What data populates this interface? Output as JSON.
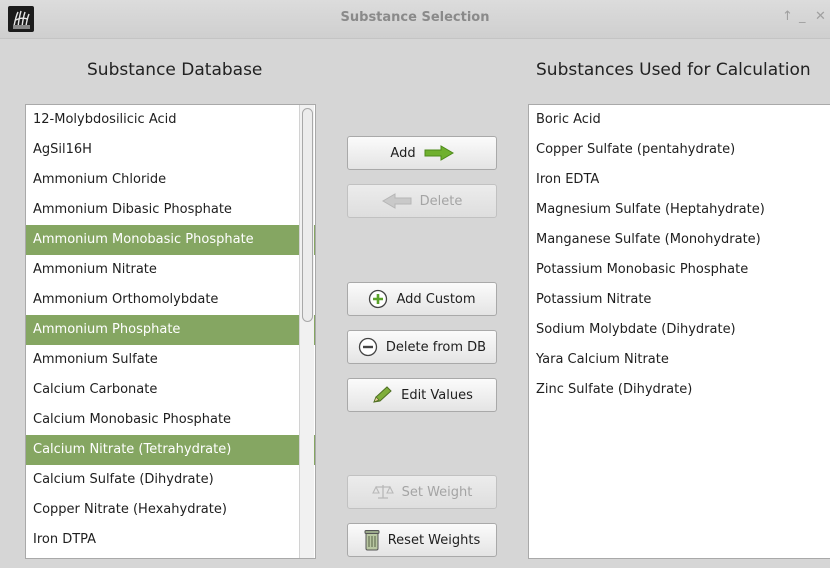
{
  "window": {
    "title": "Substance Selection",
    "controls": [
      "↑",
      "_",
      "✕"
    ]
  },
  "database": {
    "heading": "Substance Database",
    "items": [
      "12-Molybdosilicic Acid",
      "AgSil16H",
      "Ammonium Chloride",
      "Ammonium Dibasic Phosphate",
      "Ammonium Monobasic Phosphate",
      "Ammonium Nitrate",
      "Ammonium Orthomolybdate",
      "Ammonium Phosphate",
      "Ammonium Sulfate",
      "Calcium Carbonate",
      "Calcium Monobasic Phosphate",
      "Calcium Nitrate (Tetrahydrate)",
      "Calcium Sulfate (Dihydrate)",
      "Copper Nitrate (Hexahydrate)",
      "Iron DTPA"
    ],
    "selected_items": [
      "Ammonium Monobasic Phosphate",
      "Ammonium Phosphate",
      "Calcium Nitrate (Tetrahydrate)"
    ]
  },
  "used": {
    "heading": "Substances Used for Calculation",
    "items": [
      "Boric Acid",
      "Copper Sulfate (pentahydrate)",
      "Iron EDTA",
      "Magnesium Sulfate (Heptahydrate)",
      "Manganese Sulfate (Monohydrate)",
      "Potassium Monobasic Phosphate",
      "Potassium Nitrate",
      "Sodium Molybdate (Dihydrate)",
      "Yara Calcium Nitrate",
      "Zinc Sulfate (Dihydrate)"
    ]
  },
  "buttons": {
    "add": "Add",
    "delete": "Delete",
    "add_custom": "Add Custom",
    "delete_from_db": "Delete from DB",
    "edit_values": "Edit Values",
    "set_weight": "Set Weight",
    "reset_weights": "Reset Weights"
  },
  "colors": {
    "selection": "#85a662",
    "add_arrow": "#6fb02e",
    "add_custom_icon": "#5aa22a"
  }
}
